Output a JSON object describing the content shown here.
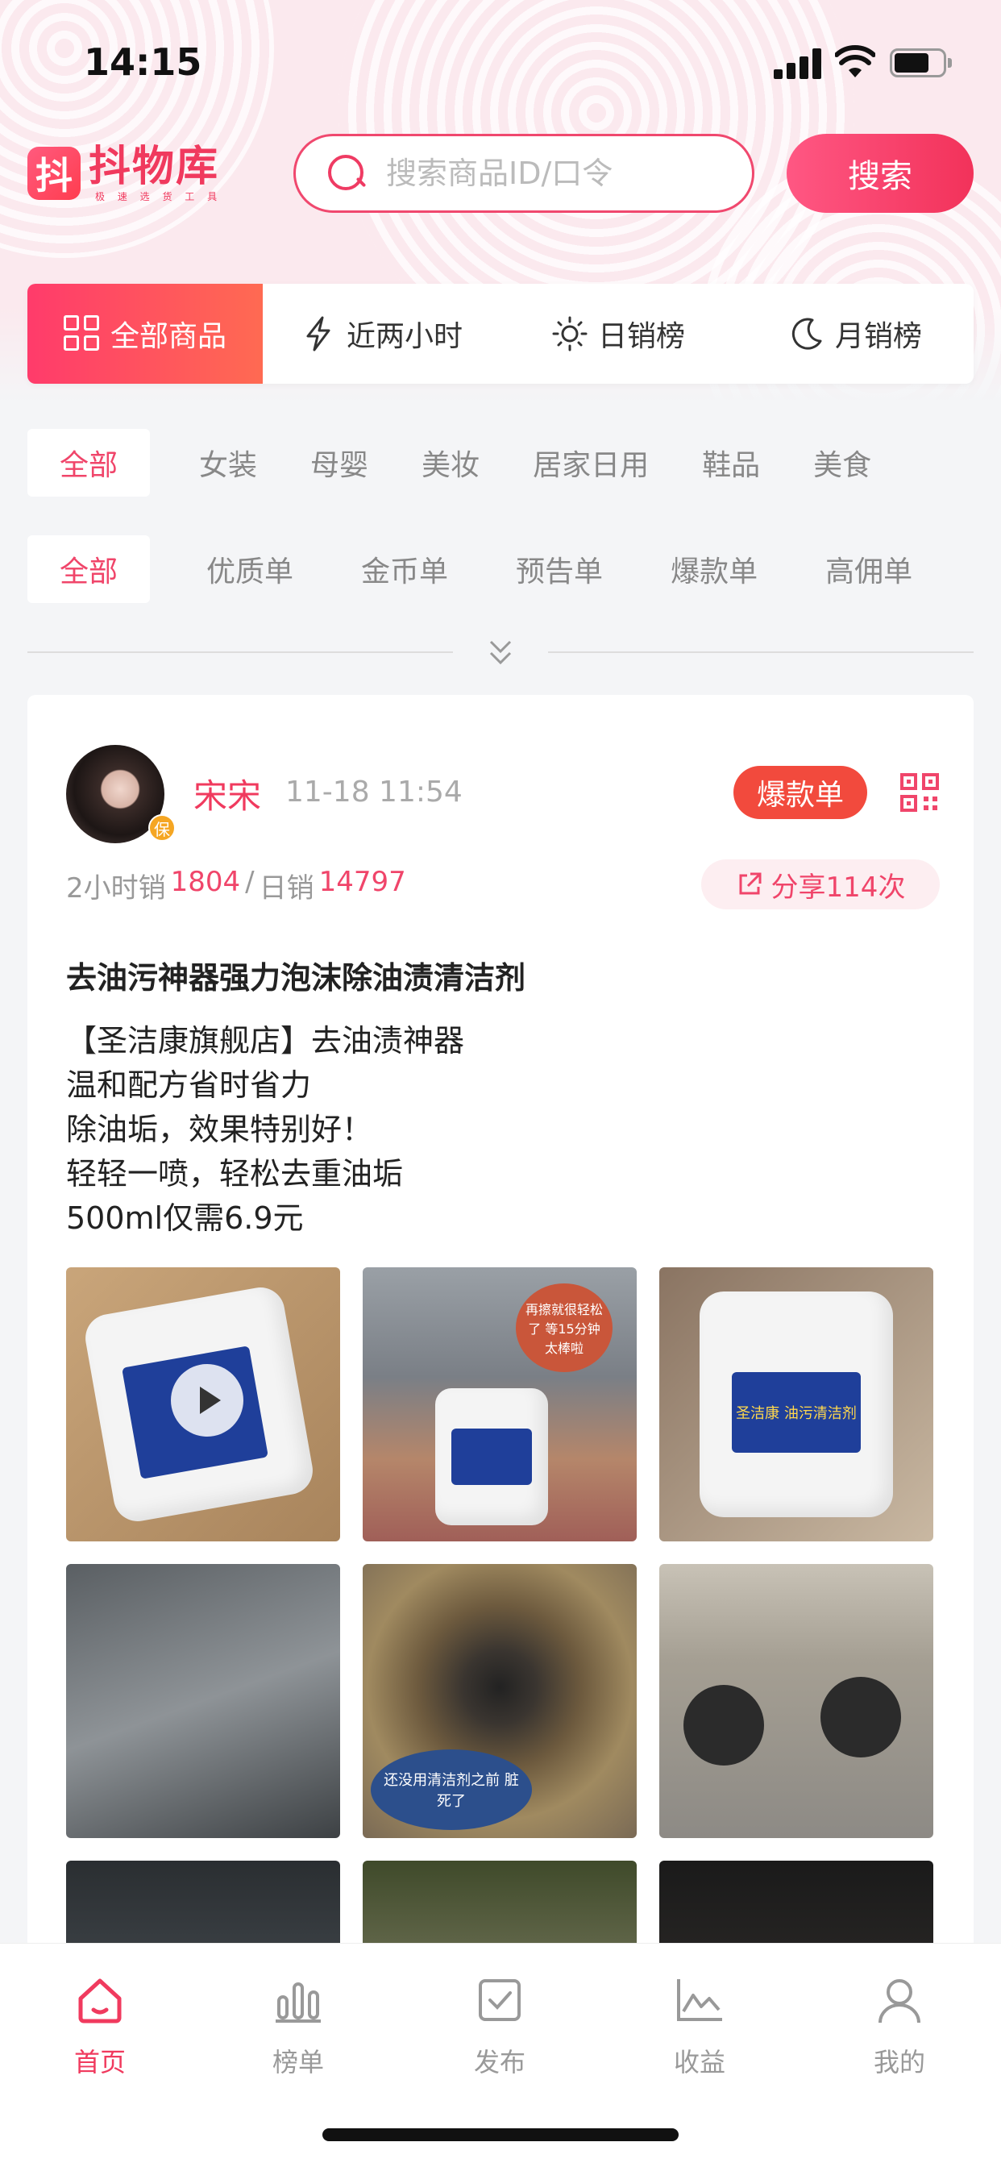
{
  "status_bar": {
    "time": "14:15"
  },
  "header": {
    "logo_mark": "抖",
    "logo_title": "抖物库",
    "logo_subtitle": "极 速 选 货 工 具",
    "search_placeholder": "搜索商品ID/口令",
    "search_button": "搜索"
  },
  "rank_tabs": [
    {
      "label": "全部商品",
      "icon": "grid-icon",
      "active": true
    },
    {
      "label": "近两小时",
      "icon": "bolt-icon",
      "active": false
    },
    {
      "label": "日销榜",
      "icon": "sun-icon",
      "active": false
    },
    {
      "label": "月销榜",
      "icon": "moon-icon",
      "active": false
    }
  ],
  "categories": [
    "全部",
    "女装",
    "母婴",
    "美妆",
    "居家日用",
    "鞋品",
    "美食"
  ],
  "order_types": [
    "全部",
    "优质单",
    "金币单",
    "预告单",
    "爆款单",
    "高佣单"
  ],
  "post": {
    "author": "宋宋",
    "time": "11-18 11:54",
    "avatar_badge": "保",
    "badge": "爆款单",
    "sales_2h_label": "2小时销",
    "sales_2h": "1804",
    "separator": "/",
    "sales_day_label": "日销",
    "sales_day": "14797",
    "share": "分享114次",
    "title": "去油污神器强力泡沫除油渍清洁剂",
    "body": [
      "【圣洁康旗舰店】去油渍神器",
      "温和配方省时省力",
      "除油垢，效果特别好！",
      "轻轻一喷，轻松去重油垢",
      "500ml仅需6.9元"
    ],
    "image_captions": {
      "img2": "再擦就很轻松了 等15分钟 太棒啦",
      "img3_label": "圣洁康 油污清洁剂",
      "img5": "还没用清洁剂之前 脏死了"
    }
  },
  "bottom_nav": [
    {
      "label": "首页",
      "icon": "home-icon",
      "active": true
    },
    {
      "label": "榜单",
      "icon": "bar-chart-icon",
      "active": false
    },
    {
      "label": "发布",
      "icon": "publish-icon",
      "active": false
    },
    {
      "label": "收益",
      "icon": "earnings-icon",
      "active": false
    },
    {
      "label": "我的",
      "icon": "user-icon",
      "active": false
    }
  ],
  "colors": {
    "accent": "#f03a5e",
    "hot_badge": "#f24a3d"
  }
}
